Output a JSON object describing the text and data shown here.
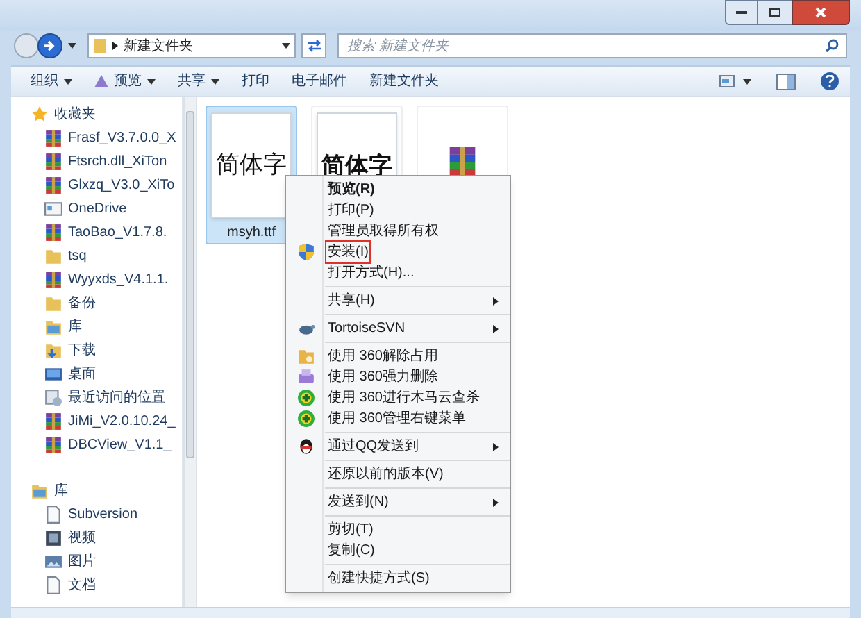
{
  "address": {
    "path": "新建文件夹",
    "search_placeholder": "搜索 新建文件夹"
  },
  "toolbar": [
    {
      "label": "组织",
      "dropdown": true,
      "kind": "plain"
    },
    {
      "label": "预览",
      "dropdown": true,
      "kind": "preview"
    },
    {
      "label": "共享",
      "dropdown": true,
      "kind": "plain"
    },
    {
      "label": "打印",
      "dropdown": false,
      "kind": "plain"
    },
    {
      "label": "电子邮件",
      "dropdown": false,
      "kind": "plain"
    },
    {
      "label": "新建文件夹",
      "dropdown": false,
      "kind": "plain"
    }
  ],
  "sidebar": {
    "groups": [
      {
        "label": "收藏夹",
        "kind": "star",
        "children": [
          {
            "label": "Frasf_V3.7.0.0_X",
            "kind": "archive"
          },
          {
            "label": "Ftsrch.dll_XiTon",
            "kind": "archive"
          },
          {
            "label": "Glxzq_V3.0_XiTo",
            "kind": "archive"
          },
          {
            "label": "OneDrive",
            "kind": "app"
          },
          {
            "label": "TaoBao_V1.7.8.",
            "kind": "archive"
          },
          {
            "label": "tsq",
            "kind": "folder"
          },
          {
            "label": "Wyyxds_V4.1.1.",
            "kind": "archive"
          },
          {
            "label": "备份",
            "kind": "folder"
          },
          {
            "label": "库",
            "kind": "library"
          },
          {
            "label": "下载",
            "kind": "download"
          },
          {
            "label": "桌面",
            "kind": "desktop"
          },
          {
            "label": "最近访问的位置",
            "kind": "recent"
          },
          {
            "label": "JiMi_V2.0.10.24_",
            "kind": "archive"
          },
          {
            "label": "DBCView_V1.1_",
            "kind": "archive"
          }
        ]
      },
      {
        "label": "库",
        "kind": "library",
        "children": [
          {
            "label": "Subversion",
            "kind": "doc"
          },
          {
            "label": "视频",
            "kind": "video"
          },
          {
            "label": "图片",
            "kind": "picture"
          },
          {
            "label": "文档",
            "kind": "doc"
          }
        ]
      }
    ]
  },
  "files": [
    {
      "kind": "font",
      "preview": "简体字",
      "bold": false,
      "name": "msyh.ttf",
      "selected": true
    },
    {
      "kind": "font",
      "preview": "简体字",
      "bold": true,
      "selected": false
    },
    {
      "kind": "archive",
      "selected": false
    }
  ],
  "context_menu": [
    {
      "kind": "plain",
      "label": "预览(R)",
      "bold": true
    },
    {
      "kind": "plain",
      "label": "打印(P)",
      "bold": false
    },
    {
      "kind": "plain",
      "label": "管理员取得所有权",
      "bold": false
    },
    {
      "kind": "shield",
      "label": "安装(I)",
      "highlighted": true
    },
    {
      "kind": "plain",
      "label": "打开方式(H)..."
    },
    {
      "kind": "separator"
    },
    {
      "kind": "plain",
      "label": "共享(H)",
      "submenu": true
    },
    {
      "kind": "separator"
    },
    {
      "kind": "turtle",
      "label": "TortoiseSVN",
      "submenu": true
    },
    {
      "kind": "separator"
    },
    {
      "kind": "unlock",
      "label": "使用 360解除占用"
    },
    {
      "kind": "shred",
      "label": "使用 360强力删除"
    },
    {
      "kind": "plus",
      "label": "使用 360进行木马云查杀"
    },
    {
      "kind": "plus",
      "label": "使用 360管理右键菜单"
    },
    {
      "kind": "separator"
    },
    {
      "kind": "penguin",
      "label": "通过QQ发送到",
      "submenu": true
    },
    {
      "kind": "separator"
    },
    {
      "kind": "plain",
      "label": "还原以前的版本(V)"
    },
    {
      "kind": "separator"
    },
    {
      "kind": "plain",
      "label": "发送到(N)",
      "submenu": true
    },
    {
      "kind": "separator"
    },
    {
      "kind": "plain",
      "label": "剪切(T)"
    },
    {
      "kind": "plain",
      "label": "复制(C)"
    },
    {
      "kind": "separator"
    },
    {
      "kind": "plain",
      "label": "创建快捷方式(S)"
    }
  ]
}
